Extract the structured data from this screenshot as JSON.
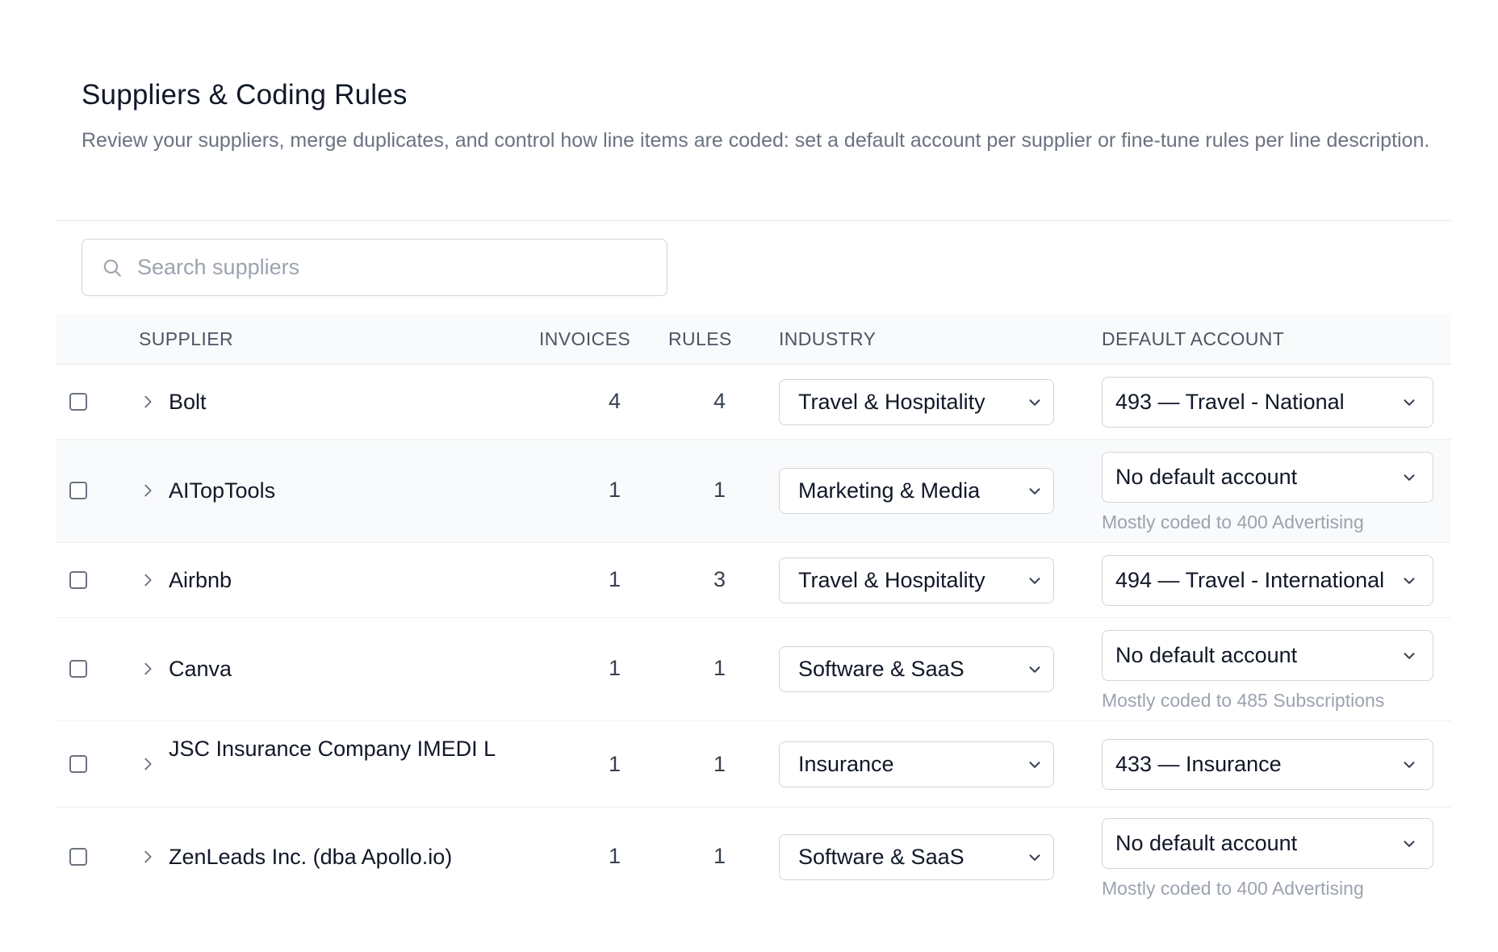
{
  "header": {
    "title": "Suppliers & Coding Rules",
    "subtitle": "Review your suppliers, merge duplicates, and control how line items are coded: set a default account per supplier or fine-tune rules per line description."
  },
  "search": {
    "placeholder": "Search suppliers",
    "value": ""
  },
  "table": {
    "columns": {
      "supplier": "SUPPLIER",
      "invoices": "INVOICES",
      "rules": "RULES",
      "industry": "INDUSTRY",
      "default_account": "DEFAULT ACCOUNT"
    },
    "rows": [
      {
        "supplier": "Bolt",
        "invoices": "4",
        "rules": "4",
        "industry": "Travel & Hospitality",
        "default_account": "493 — Travel - National",
        "hint": ""
      },
      {
        "supplier": "AITopTools",
        "invoices": "1",
        "rules": "1",
        "industry": "Marketing & Media",
        "default_account": "No default account",
        "hint": "Mostly coded to 400 Advertising"
      },
      {
        "supplier": "Airbnb",
        "invoices": "1",
        "rules": "3",
        "industry": "Travel & Hospitality",
        "default_account": "494 — Travel - International",
        "hint": ""
      },
      {
        "supplier": "Canva",
        "invoices": "1",
        "rules": "1",
        "industry": "Software & SaaS",
        "default_account": "No default account",
        "hint": "Mostly coded to 485 Subscriptions"
      },
      {
        "supplier": "JSC Insurance Company IMEDI L",
        "invoices": "1",
        "rules": "1",
        "industry": "Insurance",
        "default_account": "433 — Insurance",
        "hint": ""
      },
      {
        "supplier": "ZenLeads Inc. (dba Apollo.io)",
        "invoices": "1",
        "rules": "1",
        "industry": "Software & SaaS",
        "default_account": "No default account",
        "hint": "Mostly coded to 400 Advertising"
      }
    ]
  },
  "icons": {
    "search": "search-icon",
    "expand": "chevron-right-icon",
    "dropdown": "chevron-down-icon"
  },
  "colors": {
    "text": "#111827",
    "muted": "#6b7280",
    "border": "#d1d5db",
    "header_bg": "#f9fafb"
  }
}
